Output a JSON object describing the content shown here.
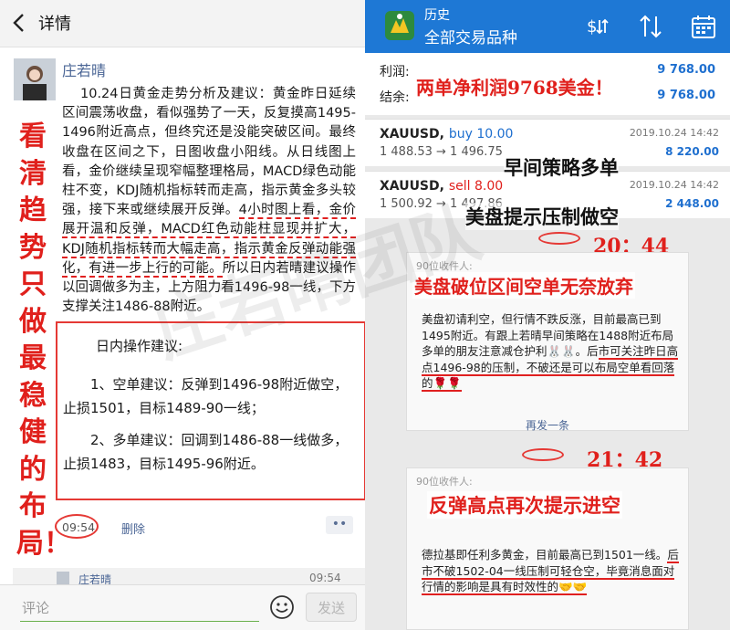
{
  "left": {
    "header": {
      "title": "详情",
      "back_icon": "chevron-left-icon"
    },
    "post": {
      "author": "庄若晴",
      "body_intro": "10.24日黄金走势分析及建议：黄金昨日延续区间震荡收盘，看似强势了一天，反复摸高1495-1496附近高点，但终究还是没能突破区间。最终收盘在区间之下，日图收盘小阳线。从日线图上看，金价继续呈现窄幅整理格局，MACD绿色动能柱不变，KDJ随机指标转而走高，指示黄金多头较强，接下来或继续展开反弹。",
      "body_highlight": "4小时图上看，金价展开温和反弹，MACD红色动能柱显现并扩大，KDJ随机指标转而大幅走高，指示黄金反弹动能强化，有进一步上行的可能。",
      "body_tail": "所以日内若晴建议操作以回调做多为主，上方阻力看1496-98一线，下方支撑关注1486-88附近。",
      "tips_title": "日内操作建议:",
      "tip_1": "1、空单建议：反弹到1496-98附近做空，止损1501，目标1489-90一线；",
      "tip_2": "2、多单建议：回调到1486-88一线做多，止损1483，目标1495-96附近。",
      "time": "09:54",
      "delete_label": "删除",
      "more_label": "••"
    },
    "vertical_caption": "看清趋势只做最稳健的布局！",
    "reply": {
      "name": "庄若晴",
      "time": "09:54"
    },
    "comment": {
      "placeholder": "评论",
      "send_label": "发送"
    }
  },
  "right": {
    "header": {
      "subtitle": "历史",
      "title": "全部交易品种",
      "icons": [
        "dollar-sort-icon",
        "sort-arrows-icon",
        "calendar-icon"
      ]
    },
    "summary": {
      "profit_label": "利润:",
      "profit_value": "9 768.00",
      "balance_label": "结余:",
      "balance_value": "9 768.00"
    },
    "callout_profit": "两单净利润9768美金！",
    "trades": [
      {
        "symbol": "XAUUSD,",
        "side": "buy 10.00",
        "prices": "1 488.53 → 1 496.75",
        "date": "2019.10.24 14:42",
        "profit": "8 220.00"
      },
      {
        "symbol": "XAUUSD,",
        "side": "sell 8.00",
        "prices": "1 500.92 → 1 497.86",
        "date": "2019.10.24 14:42",
        "profit": "2 448.00"
      }
    ],
    "callout_morning": "早间策略多单",
    "callout_us_pressure": "美盘提示压制做空",
    "time_1": "20：44",
    "callout_us_break": "美盘破位区间空单无奈放弃",
    "card_1": {
      "head": "90位收件人:",
      "body_plain": "美盘初请利空，但行情不跌反涨，目前最高已到1495附近。有跟上若晴早间策略在1488附近布局多单的朋友注意减仓护利🐰🐰。后",
      "body_underlined": "市可关注昨日高点1496-98的压制，不破还是可以布局空单看回落的🌹🌹",
      "resend": "再发一条"
    },
    "time_2": "21：42",
    "card_2": {
      "head": "90位收件人:",
      "body_plain": "德拉基即任利多黄金，目前最高已到1501一线。",
      "body_underlined": "后市不破1502-04一线压制可轻仓空，毕竟消息面对行情的影响是具有时效性的🤝🤝"
    },
    "callout_rebound": "反弹高点再次提示进空",
    "watermark": "庄若晴团队"
  },
  "colors": {
    "accent_red": "#e0201c",
    "mt4_blue": "#1e78d5",
    "link_blue": "#4a6595"
  }
}
